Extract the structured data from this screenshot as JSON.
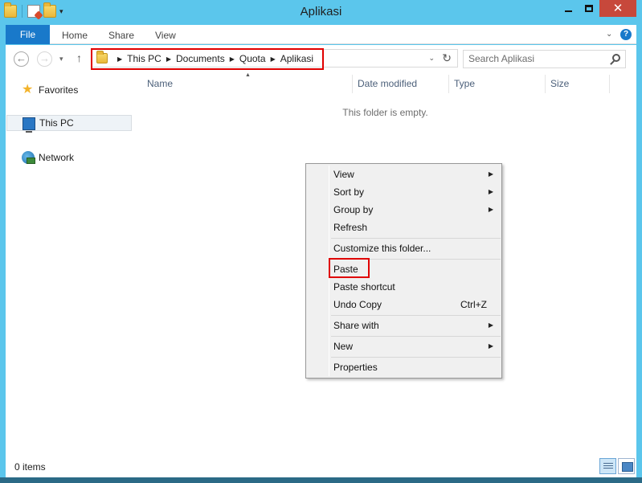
{
  "window": {
    "title": "Aplikasi",
    "controls": {
      "minimize": "minimize-icon",
      "maximize": "maximize-icon",
      "close": "close-icon"
    }
  },
  "ribbon": {
    "tabs": [
      {
        "label": "File"
      },
      {
        "label": "Home"
      },
      {
        "label": "Share"
      },
      {
        "label": "View"
      }
    ],
    "help": "?"
  },
  "address": {
    "crumbs": [
      "This PC",
      "Documents",
      "Quota",
      "Aplikasi"
    ]
  },
  "search": {
    "placeholder": "Search Aplikasi"
  },
  "nav_pane": {
    "items": [
      {
        "label": "Favorites",
        "icon": "star-icon"
      },
      {
        "label": "This PC",
        "icon": "computer-icon"
      },
      {
        "label": "Network",
        "icon": "network-icon"
      }
    ]
  },
  "file_pane": {
    "columns": [
      "Name",
      "Date modified",
      "Type",
      "Size"
    ],
    "empty_message": "This folder is empty."
  },
  "context_menu": {
    "items": [
      {
        "label": "View",
        "submenu": true
      },
      {
        "label": "Sort by",
        "submenu": true
      },
      {
        "label": "Group by",
        "submenu": true
      },
      {
        "label": "Refresh"
      },
      {
        "label": "Customize this folder..."
      },
      {
        "label": "Paste"
      },
      {
        "label": "Paste shortcut"
      },
      {
        "label": "Undo Copy",
        "shortcut": "Ctrl+Z"
      },
      {
        "label": "Share with",
        "submenu": true
      },
      {
        "label": "New",
        "submenu": true
      },
      {
        "label": "Properties"
      }
    ]
  },
  "status_bar": {
    "item_count": "0 items"
  },
  "colors": {
    "window_frame": "#5bc6ec",
    "file_tab": "#1979ca",
    "highlight": "#e00000",
    "close_button": "#c7483b"
  }
}
